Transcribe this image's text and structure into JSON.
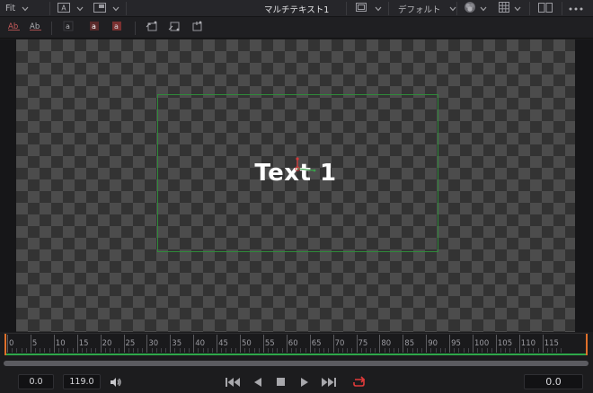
{
  "topbar": {
    "zoom_label": "Fit",
    "title": "マルチテキスト1",
    "layout_label": "デフォルト"
  },
  "viewer": {
    "text": "Text 1",
    "safe_frame_color": "#2f8a3a"
  },
  "timeline": {
    "ticks": [
      "0",
      "5",
      "10",
      "15",
      "20",
      "25",
      "30",
      "35",
      "40",
      "45",
      "50",
      "55",
      "60",
      "65",
      "70",
      "75",
      "80",
      "85",
      "90",
      "95",
      "100",
      "105",
      "110",
      "115"
    ],
    "start_marker_color": "#e0702a",
    "range_color": "#2ea84a"
  },
  "transport": {
    "render_start": "0.0",
    "render_end": "119.0",
    "current_time": "0.0",
    "loop_color": "#e03a3a"
  }
}
